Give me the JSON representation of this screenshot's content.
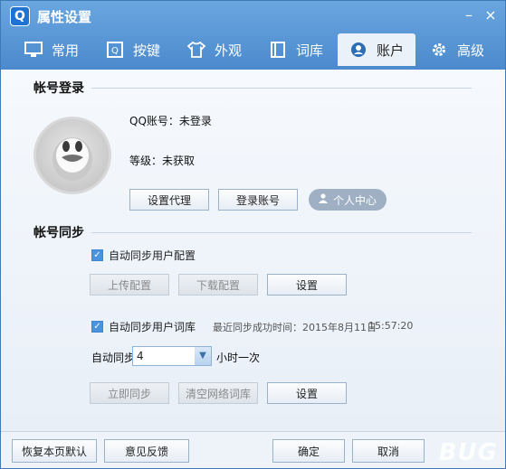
{
  "window": {
    "title": "属性设置",
    "app_icon_letter": "Q",
    "minimize": "–",
    "close": "×"
  },
  "tabs": [
    {
      "label": "常用",
      "icon": "monitor-icon"
    },
    {
      "label": "按键",
      "icon": "key-icon"
    },
    {
      "label": "外观",
      "icon": "shirt-icon"
    },
    {
      "label": "词库",
      "icon": "book-icon"
    },
    {
      "label": "账户",
      "icon": "user-circle-icon",
      "active": true
    },
    {
      "label": "高级",
      "icon": "gear-icon"
    }
  ],
  "login": {
    "section_title": "帐号登录",
    "qq_account": "QQ账号：未登录",
    "level": "等级：未获取",
    "proxy_button": "设置代理",
    "login_button": "登录账号",
    "personal_center_button": "个人中心"
  },
  "sync": {
    "section_title": "帐号同步",
    "auto_sync_config": "自动同步用户配置",
    "upload_config": "上传配置",
    "download_config": "下载配置",
    "config_settings": "设置",
    "auto_sync_lexicon": "自动同步用户词库",
    "last_sync": "最近同步成功时间：2015年8月11日",
    "last_sync_time": "15:57:20",
    "auto_sync_label": "自动同步",
    "interval_value": "4",
    "interval_suffix": "小时一次",
    "sync_now": "立即同步",
    "clear_network_lexicon": "清空网络词库",
    "lexicon_settings": "设置"
  },
  "footer": {
    "restore_defaults": "恢复本页默认",
    "feedback": "意见反馈",
    "ok": "确定",
    "cancel": "取消"
  },
  "watermark": "BUG"
}
